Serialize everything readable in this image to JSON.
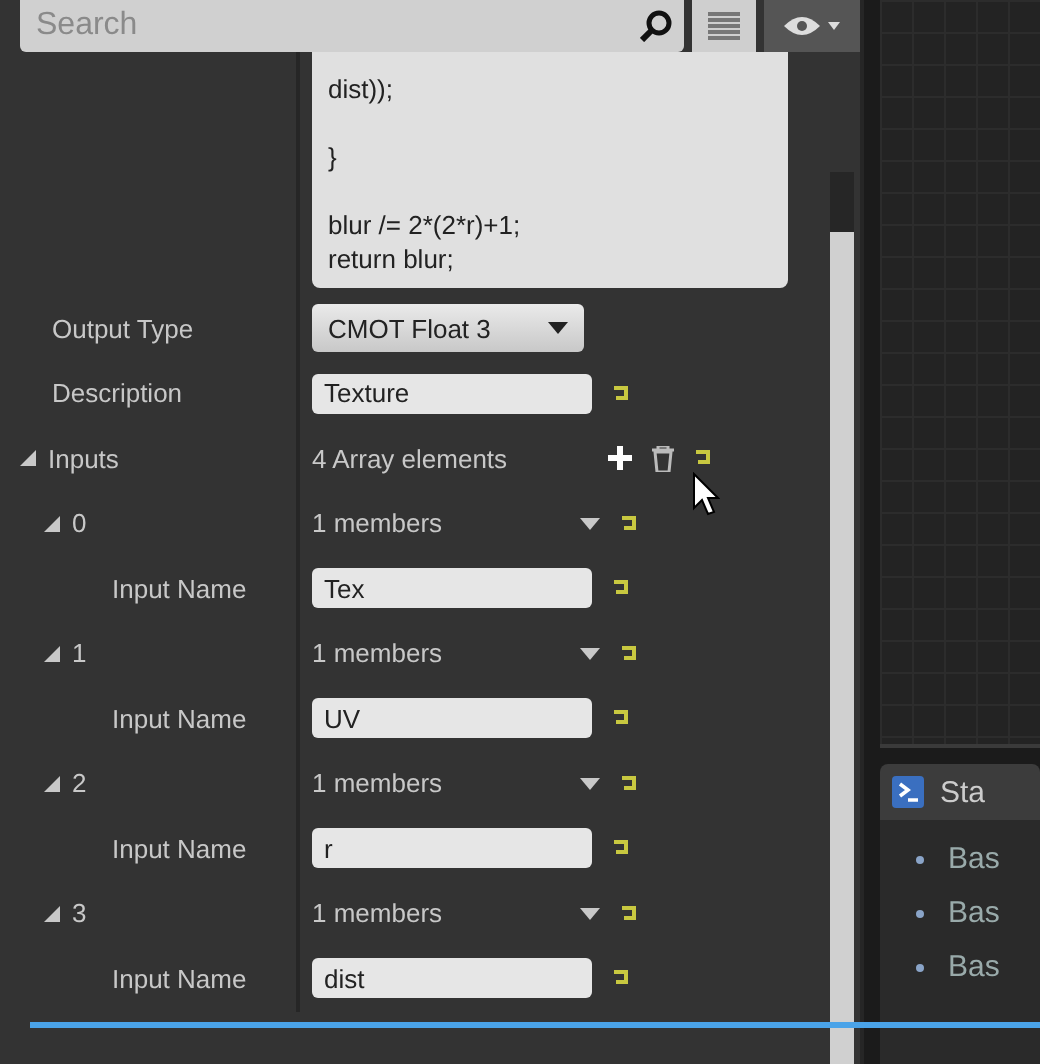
{
  "search": {
    "placeholder": "Search"
  },
  "code": {
    "text": "dist));\n\n}\n\nblur /= 2*(2*r)+1;\nreturn blur;"
  },
  "properties": [
    {
      "kind": "dropdown",
      "label": "Output Type",
      "value": "CMOT Float 3"
    },
    {
      "kind": "text",
      "label": "Description",
      "value": "Texture"
    },
    {
      "kind": "array",
      "label": "Inputs",
      "expanded": true,
      "value": "4 Array elements",
      "children": [
        {
          "kind": "struct",
          "label": "0",
          "expanded": true,
          "value": "1 members",
          "children": [
            {
              "kind": "text",
              "label": "Input Name",
              "value": "Tex"
            }
          ]
        },
        {
          "kind": "struct",
          "label": "1",
          "expanded": true,
          "value": "1 members",
          "children": [
            {
              "kind": "text",
              "label": "Input Name",
              "value": "UV"
            }
          ]
        },
        {
          "kind": "struct",
          "label": "2",
          "expanded": true,
          "value": "1 members",
          "children": [
            {
              "kind": "text",
              "label": "Input Name",
              "value": "r"
            }
          ]
        },
        {
          "kind": "struct",
          "label": "3",
          "expanded": true,
          "value": "1 members",
          "children": [
            {
              "kind": "text",
              "label": "Input Name",
              "value": "dist"
            }
          ]
        }
      ]
    }
  ],
  "stats_panel": {
    "tab": "Sta",
    "items": [
      "Bas",
      "Bas",
      "Bas"
    ]
  }
}
